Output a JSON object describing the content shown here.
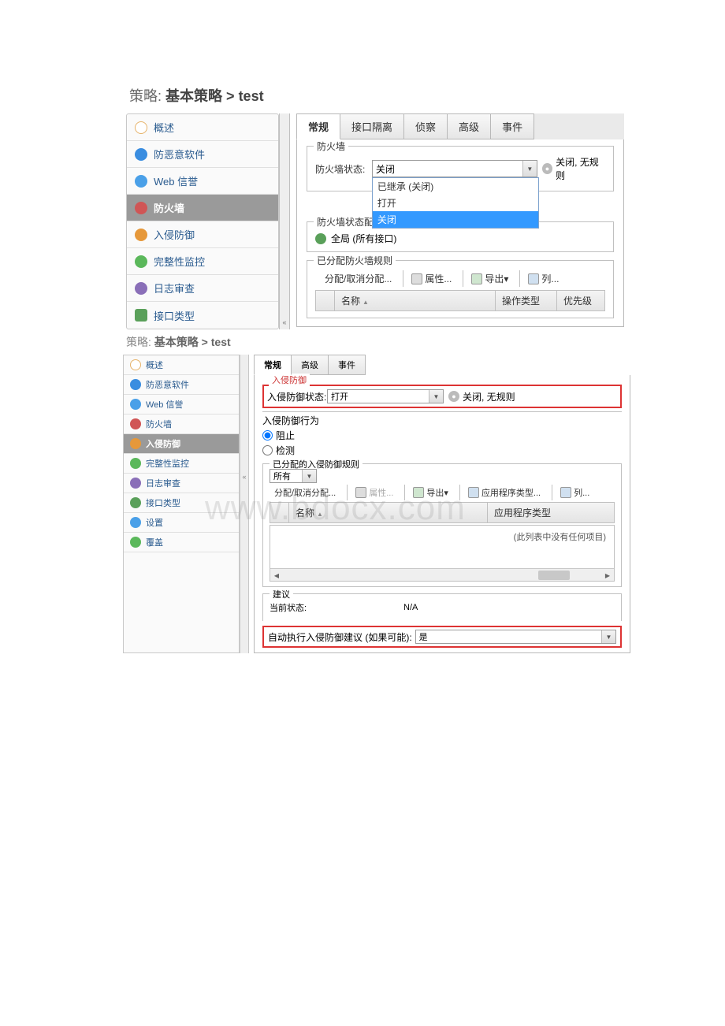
{
  "panel1": {
    "breadcrumb": {
      "prefix": "策略:",
      "path": "基本策略 >",
      "leaf": "test"
    },
    "sidebar": [
      {
        "label": "概述",
        "iconClass": "ic-overview"
      },
      {
        "label": "防恶意软件",
        "iconClass": "ic-malware"
      },
      {
        "label": "Web 信誉",
        "iconClass": "ic-web"
      },
      {
        "label": "防火墙",
        "iconClass": "ic-fw",
        "active": true
      },
      {
        "label": "入侵防御",
        "iconClass": "ic-ips"
      },
      {
        "label": "完整性监控",
        "iconClass": "ic-im"
      },
      {
        "label": "日志审查",
        "iconClass": "ic-log"
      },
      {
        "label": "接口类型",
        "iconClass": "ic-if"
      }
    ],
    "collapseGlyph": "«",
    "tabs": [
      "常规",
      "接口隔离",
      "侦察",
      "高级",
      "事件"
    ],
    "activeTab": 0,
    "fwSection": {
      "legend": "防火墙",
      "stateLabel": "防火墙状态:",
      "stateValue": "关闭",
      "options": [
        "已继承 (关闭)",
        "打开",
        "关闭"
      ],
      "highlightIdx": 2,
      "summary": "关闭, 无规则"
    },
    "cfgSection": {
      "legend": "防火墙状态配置",
      "globalLabel": "全局 (所有接口)"
    },
    "rulesSection": {
      "legend": "已分配防火墙规则",
      "toolbar": {
        "assign": "分配/取消分配...",
        "props": "属性...",
        "export": "导出",
        "cols": "列..."
      },
      "columns": [
        "",
        "名称",
        "操作类型",
        "优先级"
      ]
    }
  },
  "panel2": {
    "breadcrumb": {
      "prefix": "策略:",
      "path": "基本策略 >",
      "leaf": "test"
    },
    "sidebar": [
      {
        "label": "概述",
        "iconClass": "ic-overview"
      },
      {
        "label": "防恶意软件",
        "iconClass": "ic-malware"
      },
      {
        "label": "Web 信誉",
        "iconClass": "ic-web"
      },
      {
        "label": "防火墙",
        "iconClass": "ic-fw"
      },
      {
        "label": "入侵防御",
        "iconClass": "ic-ips",
        "active": true
      },
      {
        "label": "完整性监控",
        "iconClass": "ic-im"
      },
      {
        "label": "日志审查",
        "iconClass": "ic-log"
      },
      {
        "label": "接口类型",
        "iconClass": "ic-if"
      },
      {
        "label": "设置",
        "iconClass": "ic-web"
      },
      {
        "label": "覆盖",
        "iconClass": "ic-im"
      }
    ],
    "collapseGlyph": "«",
    "tabs": [
      "常规",
      "高级",
      "事件"
    ],
    "activeTab": 0,
    "ipsSection": {
      "legend": "入侵防御",
      "stateLabel": "入侵防御状态:",
      "stateValue": "打开",
      "summary": "关闭, 无规则"
    },
    "behaviorSection": {
      "label": "入侵防御行为",
      "opt1": "阻止",
      "opt2": "检测"
    },
    "assignedSection": {
      "legend": "已分配的入侵防御规则",
      "filterLabel": "所有",
      "toolbar": {
        "assign": "分配/取消分配...",
        "props": "属性...",
        "export": "导出",
        "appType": "应用程序类型...",
        "cols": "列..."
      },
      "columns": [
        "",
        "名称",
        "应用程序类型"
      ],
      "empty": "(此列表中没有任何项目)"
    },
    "suggestSection": {
      "legend": "建议",
      "curLabel": "当前状态:",
      "curValue": "N/A"
    },
    "autoRow": {
      "label": "自动执行入侵防御建议 (如果可能):",
      "value": "是"
    }
  },
  "watermark": "www.bdocx.com"
}
